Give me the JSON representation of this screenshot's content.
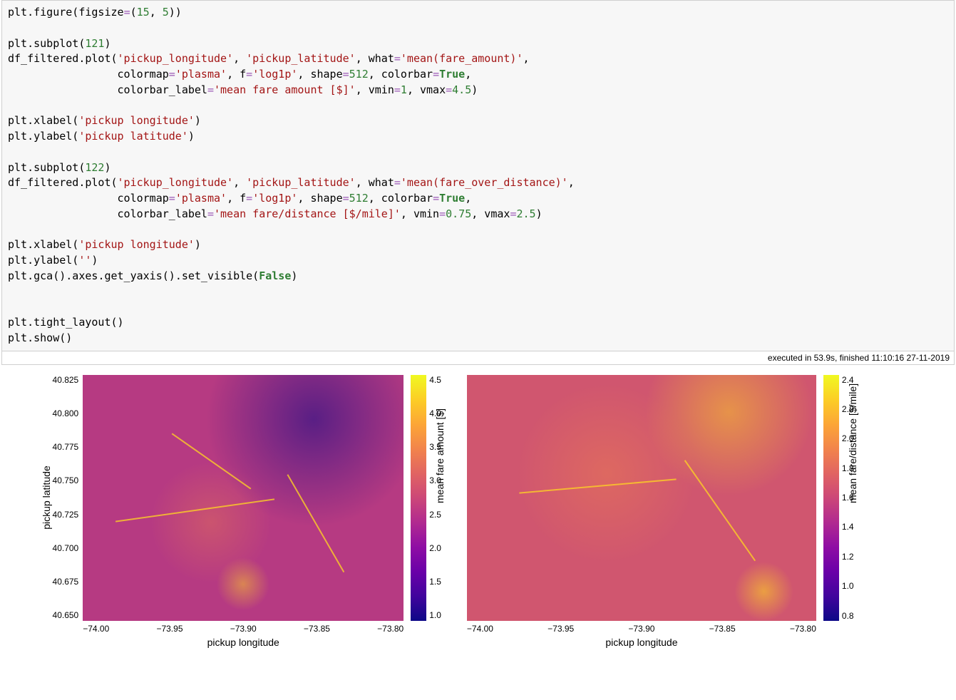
{
  "code": {
    "l1a": "plt",
    "l1b": ".figure(figsize",
    "l1c": "=",
    "l1d": "(",
    "l1e": "15",
    "l1f": ", ",
    "l1g": "5",
    "l1h": "))",
    "l2a": "plt",
    "l2b": ".subplot(",
    "l2c": "121",
    "l2d": ")",
    "l3a": "df_filtered",
    "l3b": ".plot(",
    "l3c": "'pickup_longitude'",
    "l3d": ", ",
    "l3e": "'pickup_latitude'",
    "l3f": ", what",
    "l3g": "=",
    "l3h": "'mean(fare_amount)'",
    "l3i": ",",
    "l4a": "                 colormap",
    "l4b": "=",
    "l4c": "'plasma'",
    "l4d": ", f",
    "l4e": "=",
    "l4f": "'log1p'",
    "l4g": ", shape",
    "l4h": "=",
    "l4i": "512",
    "l4j": ", colorbar",
    "l4k": "=",
    "l4l": "True",
    "l4m": ",",
    "l5a": "                 colorbar_label",
    "l5b": "=",
    "l5c": "'mean fare amount [$]'",
    "l5d": ", vmin",
    "l5e": "=",
    "l5f": "1",
    "l5g": ", vmax",
    "l5h": "=",
    "l5i": "4.5",
    "l5j": ")",
    "l6a": "plt",
    "l6b": ".xlabel(",
    "l6c": "'pickup longitude'",
    "l6d": ")",
    "l7a": "plt",
    "l7b": ".ylabel(",
    "l7c": "'pickup latitude'",
    "l7d": ")",
    "l8a": "plt",
    "l8b": ".subplot(",
    "l8c": "122",
    "l8d": ")",
    "l9a": "df_filtered",
    "l9b": ".plot(",
    "l9c": "'pickup_longitude'",
    "l9d": ", ",
    "l9e": "'pickup_latitude'",
    "l9f": ", what",
    "l9g": "=",
    "l9h": "'mean(fare_over_distance)'",
    "l9i": ",",
    "l10a": "                 colormap",
    "l10b": "=",
    "l10c": "'plasma'",
    "l10d": ", f",
    "l10e": "=",
    "l10f": "'log1p'",
    "l10g": ", shape",
    "l10h": "=",
    "l10i": "512",
    "l10j": ", colorbar",
    "l10k": "=",
    "l10l": "True",
    "l10m": ",",
    "l11a": "                 colorbar_label",
    "l11b": "=",
    "l11c": "'mean fare/distance [$/mile]'",
    "l11d": ", vmin",
    "l11e": "=",
    "l11f": "0.75",
    "l11g": ", vmax",
    "l11h": "=",
    "l11i": "2.5",
    "l11j": ")",
    "l12a": "plt",
    "l12b": ".xlabel(",
    "l12c": "'pickup longitude'",
    "l12d": ")",
    "l13a": "plt",
    "l13b": ".ylabel(",
    "l13c": "''",
    "l13d": ")",
    "l14a": "plt",
    "l14b": ".gca()",
    "l14c": ".axes",
    "l14d": ".get_yaxis()",
    "l14e": ".set_visible(",
    "l14f": "False",
    "l14g": ")",
    "l15a": "plt",
    "l15b": ".tight_layout()",
    "l16a": "plt",
    "l16b": ".show()"
  },
  "exec": "executed in 53.9s, finished 11:10:16 27-11-2019",
  "chart_data": [
    {
      "type": "heatmap",
      "what": "mean(fare_amount)",
      "colormap": "plasma",
      "transform": "log1p",
      "shape": 512,
      "xlabel": "pickup longitude",
      "ylabel": "pickup latitude",
      "xlim": [
        -74.02,
        -73.77
      ],
      "ylim": [
        40.64,
        40.84
      ],
      "xticks": [
        "−74.00",
        "−73.95",
        "−73.90",
        "−73.85",
        "−73.80"
      ],
      "yticks": [
        "40.825",
        "40.800",
        "40.775",
        "40.750",
        "40.725",
        "40.700",
        "40.675",
        "40.650"
      ],
      "colorbar": {
        "label": "mean fare amount [$]",
        "vmin": 1,
        "vmax": 4.5,
        "ticks": [
          "4.5",
          "4.0",
          "3.5",
          "3.0",
          "2.5",
          "2.0",
          "1.5",
          "1.0"
        ]
      }
    },
    {
      "type": "heatmap",
      "what": "mean(fare_over_distance)",
      "colormap": "plasma",
      "transform": "log1p",
      "shape": 512,
      "xlabel": "pickup longitude",
      "ylabel": "",
      "yaxis_visible": false,
      "xlim": [
        -74.02,
        -73.77
      ],
      "ylim": [
        40.64,
        40.84
      ],
      "xticks": [
        "−74.00",
        "−73.95",
        "−73.90",
        "−73.85",
        "−73.80"
      ],
      "colorbar": {
        "label": "mean fare/distance [$/mile]",
        "vmin": 0.75,
        "vmax": 2.5,
        "ticks": [
          "2.4",
          "2.2",
          "2.0",
          "1.8",
          "1.6",
          "1.4",
          "1.2",
          "1.0",
          "0.8"
        ]
      }
    }
  ]
}
